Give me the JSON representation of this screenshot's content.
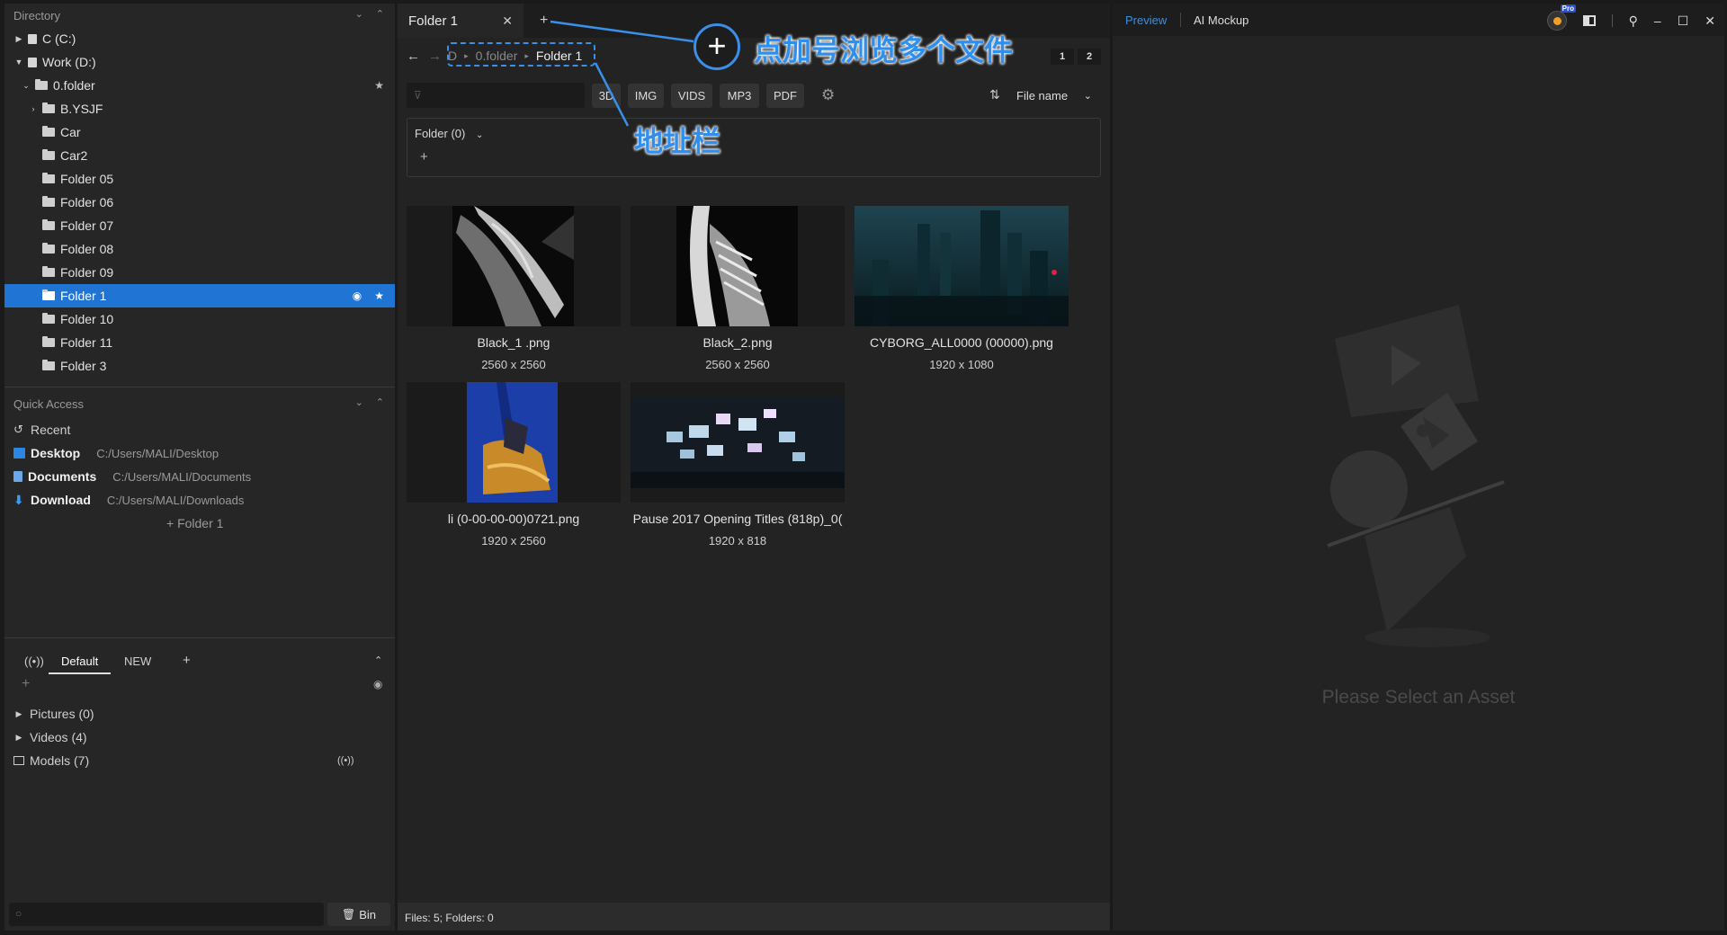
{
  "directory": {
    "title": "Directory",
    "items": [
      {
        "label": "C (C:)",
        "kind": "drive",
        "expanded": false
      },
      {
        "label": "Work (D:)",
        "kind": "drive",
        "expanded": true
      },
      {
        "label": "0.folder",
        "kind": "folder",
        "expanded": true
      },
      {
        "label": "B.YSJF",
        "kind": "folder",
        "expanded": false
      },
      {
        "label": "Car",
        "kind": "folder"
      },
      {
        "label": "Car2",
        "kind": "folder"
      },
      {
        "label": "Folder 05",
        "kind": "folder"
      },
      {
        "label": "Folder 06",
        "kind": "folder"
      },
      {
        "label": "Folder 07",
        "kind": "folder"
      },
      {
        "label": "Folder 08",
        "kind": "folder"
      },
      {
        "label": "Folder 09",
        "kind": "folder"
      },
      {
        "label": "Folder 1",
        "kind": "folder",
        "selected": true
      },
      {
        "label": "Folder 10",
        "kind": "folder"
      },
      {
        "label": "Folder 11",
        "kind": "folder"
      },
      {
        "label": "Folder 3",
        "kind": "folder"
      }
    ]
  },
  "quick_access": {
    "title": "Quick Access",
    "recent": "Recent",
    "items": [
      {
        "label": "Desktop",
        "path": "C:/Users/MALI/Desktop"
      },
      {
        "label": "Documents",
        "path": "C:/Users/MALI/Documents"
      },
      {
        "label": "Download",
        "path": "C:/Users/MALI/Downloads"
      }
    ],
    "pinned": "+ Folder 1"
  },
  "collections": {
    "tabs": [
      "Default",
      "NEW"
    ],
    "active_tab": "Default",
    "items": [
      {
        "label": "Pictures (0)"
      },
      {
        "label": "Videos (4)"
      },
      {
        "label": "Models (7)"
      }
    ]
  },
  "bin_label": "Bin",
  "tab": {
    "title": "Folder 1"
  },
  "breadcrumb": [
    "D",
    "0.folder",
    "Folder 1"
  ],
  "view_buttons": [
    "1",
    "2"
  ],
  "filters": [
    "3D",
    "IMG",
    "VIDS",
    "MP3",
    "PDF"
  ],
  "sort": {
    "label": "File name"
  },
  "folder_section": {
    "title": "Folder (0)"
  },
  "assets": [
    {
      "name": "Black_1 .png",
      "dims": "2560 x 2560"
    },
    {
      "name": "Black_2.png",
      "dims": "2560 x 2560"
    },
    {
      "name": "CYBORG_ALL0000 (00000).png",
      "dims": "1920 x 1080"
    },
    {
      "name": "li (0-00-00-00)0721.png",
      "dims": "1920 x 2560"
    },
    {
      "name": "Pause 2017 Opening Titles (818p)_0(",
      "dims": "1920 x 818"
    }
  ],
  "status": "Files: 5; Folders: 0",
  "preview": {
    "tabs": [
      "Preview",
      "AI Mockup"
    ],
    "placeholder": "Please Select an Asset",
    "pro_badge": "Pro"
  },
  "annotations": {
    "add_tab": "点加号浏览多个文件",
    "address_bar": "地址栏"
  },
  "colors": {
    "accent": "#1f74d4",
    "annotation": "#2f8fef"
  }
}
